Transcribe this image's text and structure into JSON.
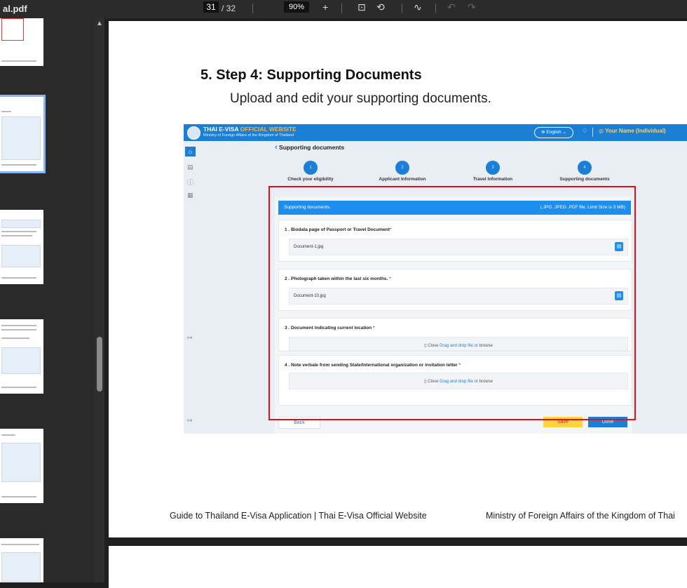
{
  "viewer": {
    "filename": "al.pdf",
    "current_page": "31",
    "total_pages": "/ 32",
    "zoom": "90%",
    "toolbar_icons": [
      "zoom-in-icon",
      "fit-page-icon",
      "rotate-icon",
      "highlight-icon",
      "undo-icon",
      "redo-icon"
    ]
  },
  "page": {
    "heading": "5. Step 4: Supporting Documents",
    "subheading": "Upload and edit your supporting documents.",
    "footer_left": "Guide to Thailand E-Visa Application | Thai E-Visa Official Website",
    "footer_right": "Ministry of Foreign Affairs of the Kingdom of Thai"
  },
  "screenshot": {
    "title_white": "THAI E-VISA",
    "title_orange": "OFFICIAL WEBSITE",
    "subtitle": "Ministry of Foreign Affairs of the Kingdom of Thailand",
    "language": "⊕ English ⌄",
    "user": "Your Name (Individual)",
    "back_label": "Supporting documents",
    "steps": [
      {
        "num": "1",
        "label": "Check your eligibility"
      },
      {
        "num": "2",
        "label": "Applicant Information"
      },
      {
        "num": "3",
        "label": "Travel Information"
      },
      {
        "num": "4",
        "label": "Supporting documents"
      }
    ],
    "panel_title": "Supporting documents.",
    "panel_note": "(.JPG .JPEG .PDF file, Limit Size is 3 MB)",
    "docs": [
      {
        "title": "1 . Biodata page of Passport or Travel Document",
        "value": "Document-1.jpg"
      },
      {
        "title": "2 . Photograph taken within the last six months.",
        "value": "Document-10.jpg"
      },
      {
        "title": "3 . Document indicating current location",
        "drop_prefix": "Close",
        "drop_link": "Drag and drop file or",
        "drop_suffix": "browse"
      },
      {
        "title": "4 . Note verbale from sending State/International organization or invitation letter",
        "drop_prefix": "Close",
        "drop_link": "Drag and drop file or",
        "drop_suffix": "browse"
      }
    ],
    "btn_back": "Back",
    "btn_save": "Save",
    "btn_done": "Done"
  }
}
